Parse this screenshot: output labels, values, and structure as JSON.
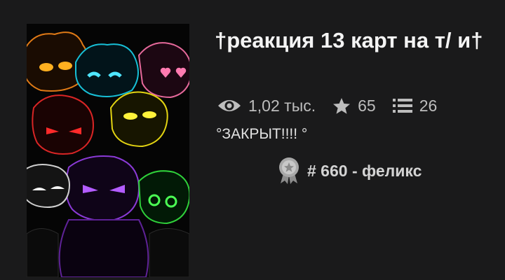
{
  "story": {
    "title": "†реакция 13 карт на т/ и†",
    "cover_icon": "fanart-cover-image",
    "stats": {
      "views": "1,02 тыс.",
      "views_icon": "eye-icon",
      "stars": "65",
      "stars_icon": "star-icon",
      "parts": "26",
      "parts_icon": "list-icon"
    },
    "status": "°ЗАКРЫТ!!!! °",
    "rank": {
      "text": "# 660 - феликс",
      "icon": "rank-badge-icon"
    }
  },
  "colors": {
    "background": "#1a1a1b",
    "title": "#f4f4f4",
    "stats": "#bdbdbd"
  }
}
